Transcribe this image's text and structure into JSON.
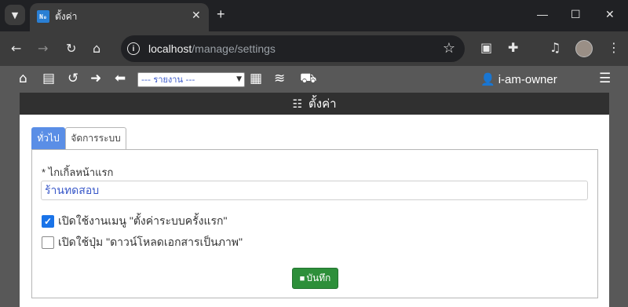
{
  "browser": {
    "tab_title": "ตั้งค่า",
    "favicon_text": "N₀",
    "url_host": "localhost",
    "url_path": "/manage/settings"
  },
  "toolbar": {
    "report_select_value": "--- รายงาน ---",
    "user_name": "i-am-owner"
  },
  "page": {
    "title": "ตั้งค่า"
  },
  "tabs": [
    {
      "label": "ทั่วไป",
      "active": true
    },
    {
      "label": "จัดการระบบ",
      "active": false
    }
  ],
  "form": {
    "greeting_label": "* ไกเกิ้ลหน้าแรก",
    "greeting_value": "ร้านทดสอบ",
    "checkbox_setup_menu": {
      "label": "เปิดใช้งานเมนู \"ตั้งค่าระบบครั้งแรก\"",
      "checked": true
    },
    "checkbox_download_image": {
      "label": "เปิดใช้ปุ่ม \"ดาวน์โหลดเอกสารเป็นภาพ\"",
      "checked": false
    },
    "save_label": "บันทึก"
  }
}
